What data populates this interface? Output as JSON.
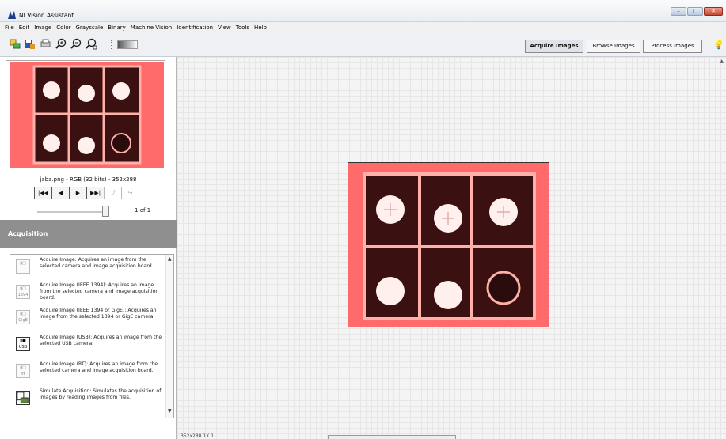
{
  "window": {
    "title": "NI Vision Assistant",
    "controls": [
      "minimize",
      "maximize",
      "close"
    ]
  },
  "menu": [
    "File",
    "Edit",
    "Image",
    "Color",
    "Grayscale",
    "Binary",
    "Machine Vision",
    "Identification",
    "View",
    "Tools",
    "Help"
  ],
  "toolbar": {
    "icons": [
      "acquire-icon",
      "save-icon",
      "print-icon",
      "zoom-in-icon",
      "zoom-out-icon",
      "zoom-fit-icon",
      "palette-icon"
    ],
    "mode_tabs": [
      {
        "label": "Acquire Images",
        "active": true
      },
      {
        "label": "Browse Images",
        "active": false
      },
      {
        "label": "Process Images",
        "active": false
      }
    ]
  },
  "preview": {
    "file_info": "jaba.png - RGB (32 bits) - 352x288",
    "page": "1",
    "of_label": "of",
    "total": "1"
  },
  "acquisition": {
    "header": "Acquisition",
    "items": [
      {
        "icon": "camera-icon",
        "icon_text": "",
        "text": "Acquire Image:  Acquires an image from the selected camera and image acquisition board."
      },
      {
        "icon": "ieee1394-camera-icon",
        "icon_text": "1394",
        "text": "Acquire Image (IEEE 1394): Acquires an image from the selected camera and image acquisition board."
      },
      {
        "icon": "gige-camera-icon",
        "icon_text": "GigE",
        "text": "Acquire Image (IEEE 1394 or GigE): Acquires an image from the selected 1394 or GigE camera."
      },
      {
        "icon": "usb-camera-icon",
        "icon_text": "USB",
        "text": "Acquire Image (USB):  Acquires an image from the selected USB camera."
      },
      {
        "icon": "rt-camera-icon",
        "icon_text": "RT",
        "text": "Acquire Image (RT): Acquires an image from the selected camera and image acquisition board."
      },
      {
        "icon": "simulate-acquisition-icon",
        "icon_text": "",
        "text": "Simulate Acquisition:  Simulates the acquisition of images by reading images from files."
      }
    ]
  },
  "status": {
    "text": "352x288 1X  1"
  },
  "colors": {
    "image_tint": "#ff6b6b",
    "panel_header": "#8f8f8f"
  }
}
